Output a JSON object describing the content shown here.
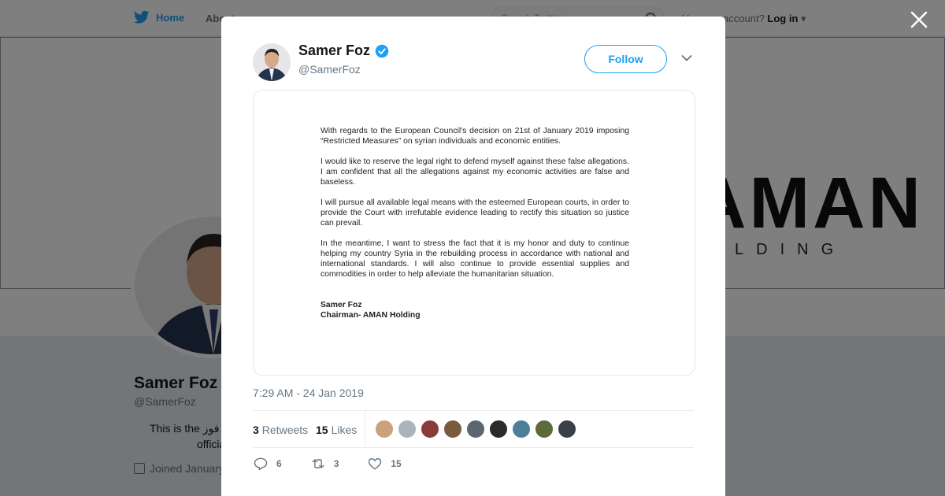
{
  "topbar": {
    "home_label": "Home",
    "about_label": "About",
    "search_placeholder": "Search Twitter",
    "account_prompt": "Have an account?",
    "login_label": "Log in"
  },
  "banner": {
    "logo_text": "AMAN",
    "sub_text": "HOLDING"
  },
  "profile": {
    "name": "Samer Foz",
    "handle": "@SamerFoz",
    "bio_line1": "This is the سامر فوز",
    "bio_line2": "official",
    "joined": "Joined January"
  },
  "tweet": {
    "author_name": "Samer Foz",
    "author_handle": "@SamerFoz",
    "follow_label": "Follow",
    "timestamp": "7:29 AM - 24 Jan 2019",
    "retweets_count": "3",
    "retweets_label": "Retweets",
    "likes_count": "15",
    "likes_label": "Likes",
    "reply_count": "6",
    "retweet_action_count": "3",
    "like_action_count": "15",
    "document": {
      "p1": "With regards to the European Council's decision on 21st of January 2019 imposing “Restricted Measures” on syrian individuals and economic entities.",
      "p2": "I would like to reserve the legal right to defend myself against these false allegations. I am confident that all the allegations against my economic activities are false and baseless.",
      "p3": "I will pursue all available legal means with the esteemed European courts, in order to provide the Court with irrefutable evidence leading to rectify this situation so justice can prevail.",
      "p4": "In the meantime, I want to stress the fact that it is my honor and duty to continue helping my country Syria in the rebuilding process in accordance with national and international standards. I will also continue to provide essential supplies and commodities in order to help alleviate the humanitarian situation.",
      "sig_name": "Samer Foz",
      "sig_title": "Chairman- AMAN Holding"
    }
  },
  "colors": {
    "brand_blue": "#1da1f2",
    "secondary_text": "#657786",
    "liker_avatars": [
      "#c9a27a",
      "#aab4bd",
      "#8b3a3a",
      "#7a5a3c",
      "#5c6670",
      "#2b2b2b",
      "#4e7f9a",
      "#5c6b3a",
      "#3b4048"
    ]
  }
}
